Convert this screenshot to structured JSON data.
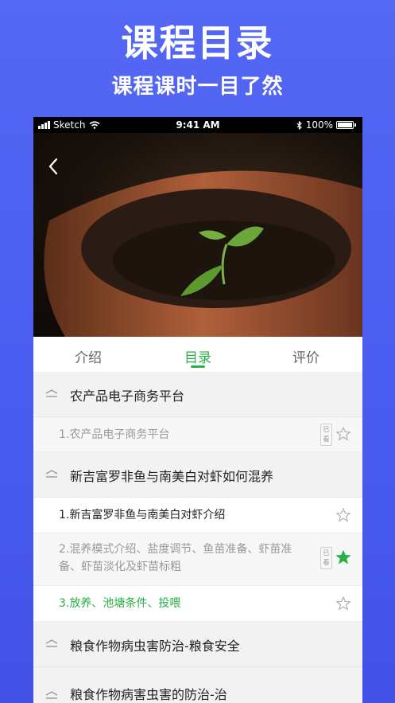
{
  "banner": {
    "title": "课程目录",
    "subtitle": "课程课时一目了然"
  },
  "status_bar": {
    "carrier": "Sketch",
    "time": "9:41 AM",
    "battery": "100%"
  },
  "tabs": [
    {
      "label": "介绍",
      "active": false
    },
    {
      "label": "目录",
      "active": true
    },
    {
      "label": "评价",
      "active": false
    }
  ],
  "colors": {
    "accent": "#27b243",
    "banner_bg": "#4a5cf0"
  },
  "sections": [
    {
      "title": "农产品电子商务平台",
      "items": [
        {
          "text": "1.农产品电子商务平台",
          "seen_label": "已看",
          "starred": false,
          "state": "read"
        }
      ]
    },
    {
      "title": "新吉富罗非鱼与南美白对虾如何混养",
      "items": [
        {
          "text": "1.新吉富罗非鱼与南美白对虾介绍",
          "seen_label": "",
          "starred": false,
          "state": "normal"
        },
        {
          "text": "2.混养模式介绍、盐度调节、鱼苗准备、虾苗准备、虾苗淡化及虾苗标粗",
          "seen_label": "已看",
          "starred": true,
          "state": "read"
        },
        {
          "text": "3.放养、池塘条件、投喂",
          "seen_label": "",
          "starred": false,
          "state": "current"
        }
      ]
    },
    {
      "title": "粮食作物病虫害防治-粮食安全",
      "items": []
    },
    {
      "title": "粮食作物病害虫害的防治-治",
      "items": []
    }
  ]
}
